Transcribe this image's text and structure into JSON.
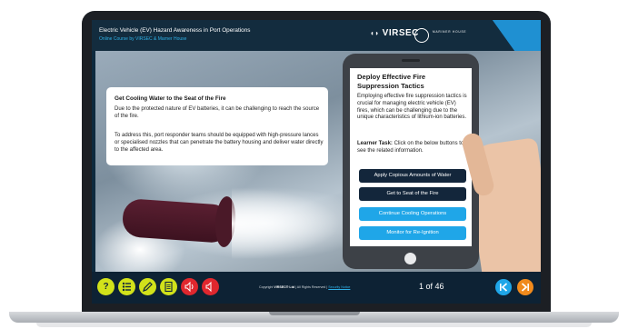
{
  "header": {
    "course_title": "Electric Vehicle (EV) Hazard Awareness in Port Operations",
    "course_subtitle": "Online Course by VIRSEC & Marner House",
    "logo_text": "VIRSEC",
    "partner_logo": "MARINER HOUSE"
  },
  "info_box": {
    "title": "Get Cooling Water to the Seat of the Fire",
    "paragraph1": "Due to the protected nature of EV batteries, it can be challenging to reach the source of the fire.",
    "paragraph2": "To address this, port responder teams should be equipped with high-pressure lances or specialised nozzles that can penetrate the battery housing and deliver water directly to the affected area."
  },
  "phone": {
    "title": "Deploy Effective Fire Suppression Tactics",
    "body": "Employing effective fire suppression tactics is crucial for managing electric vehicle (EV) fires, which can be challenging due to the unique characteristics of lithium-ion batteries.",
    "task_label": "Learner Task:",
    "task_text": "Click on the below buttons to see the related information.",
    "buttons": [
      {
        "label": "Apply Copious Amounts of Water",
        "style": "dark"
      },
      {
        "label": "Get to Seat of the Fire",
        "style": "dark"
      },
      {
        "label": "Continue Cooling Operations",
        "style": "blue"
      },
      {
        "label": "Monitor for Re-Ignition",
        "style": "blue"
      }
    ]
  },
  "footer": {
    "help_label": "?",
    "copyright_prefix": "Copyright ",
    "copyright_brand": "VIRSEC® Ltd",
    "copyright_suffix": " | All Rights Reserved | ",
    "security_link": "Security Notice",
    "page_indicator": "1 of 46",
    "icons": [
      "help-icon",
      "menu-list-icon",
      "pencil-icon",
      "notes-icon",
      "audio-icon",
      "mute-icon"
    ]
  },
  "colors": {
    "accent_yellow": "#d2e21a",
    "accent_red": "#e0272e",
    "accent_blue": "#1fa6e8",
    "accent_orange": "#f08a1c",
    "nav_dark": "#13263b"
  }
}
